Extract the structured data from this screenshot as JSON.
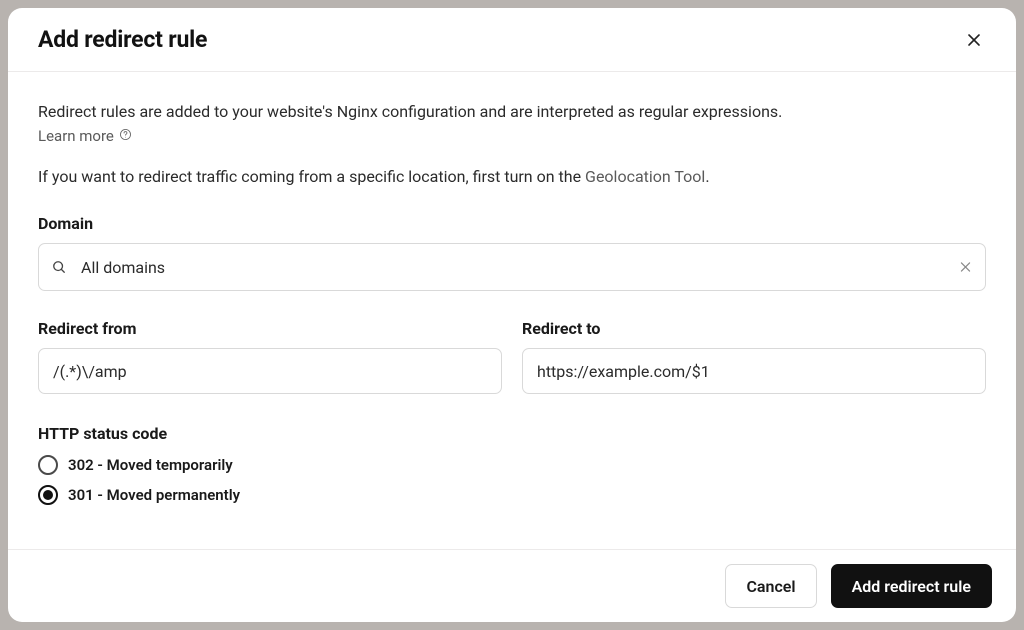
{
  "modal": {
    "title": "Add redirect rule",
    "description": "Redirect rules are added to your website's Nginx configuration and are interpreted as regular expressions.",
    "learn_more_label": "Learn more",
    "geo_prefix": "If you want to redirect traffic coming from a specific location, first turn on the ",
    "geo_link_label": "Geolocation Tool",
    "geo_suffix": "."
  },
  "fields": {
    "domain": {
      "label": "Domain",
      "value": "All domains"
    },
    "redirect_from": {
      "label": "Redirect from",
      "value": "/(.*)\\/amp"
    },
    "redirect_to": {
      "label": "Redirect to",
      "value": "https://example.com/$1"
    },
    "status_code": {
      "label": "HTTP status code",
      "options": [
        {
          "value": "302",
          "label": "302 - Moved temporarily",
          "selected": false
        },
        {
          "value": "301",
          "label": "301 - Moved permanently",
          "selected": true
        }
      ]
    }
  },
  "footer": {
    "cancel_label": "Cancel",
    "submit_label": "Add redirect rule"
  }
}
